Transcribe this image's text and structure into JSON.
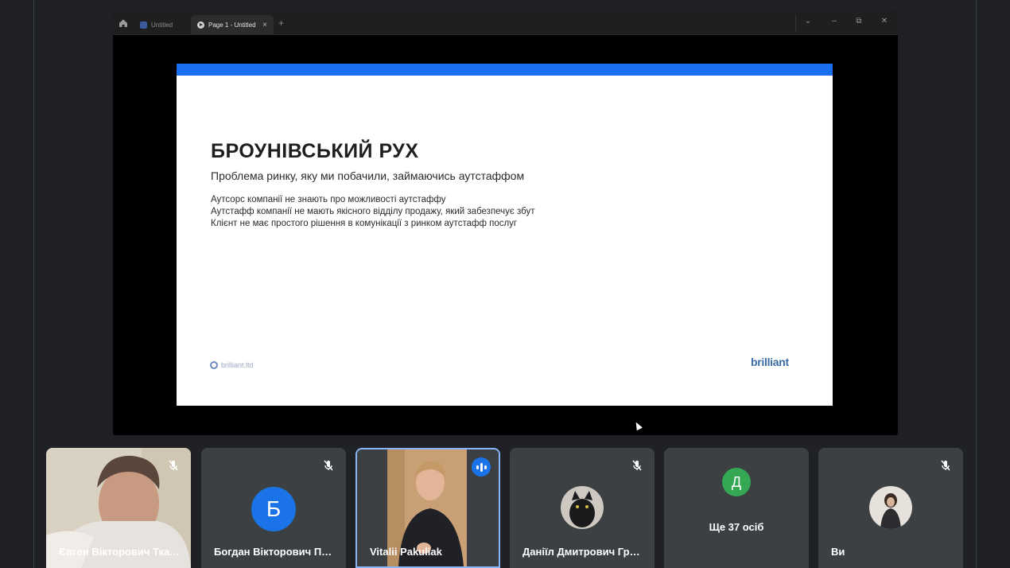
{
  "screen": {
    "tabs": [
      {
        "label": "Untitled"
      },
      {
        "label": "Page 1 - Untitled",
        "close": "×"
      }
    ],
    "add_tab": "+",
    "window_controls": {
      "chevron": "⌄",
      "minimize": "–",
      "restore": "⧉",
      "close": "✕"
    }
  },
  "slide": {
    "title": "БРОУНІВСЬКИЙ РУХ",
    "subtitle": "Проблема ринку, яку ми побачили, займаючись аутстаффом",
    "lines": [
      "Аутсорс компанії не знають про можливості аутстаффу",
      "Аутстафф компанії не мають якісного відділу продажу, який забезпечує збут",
      "Клієнт не має простого рішення в комунікації з ринком аутстафф послуг"
    ],
    "footer_left": "brilliant.ltd",
    "footer_right": "brilliant"
  },
  "participants": [
    {
      "name": "Євген Вікторович Ткачук",
      "muted": true
    },
    {
      "name": "Богдан Вікторович Петренко",
      "muted": true,
      "initial": "Б",
      "color": "#1a73e8"
    },
    {
      "name": "Vitalii Pakuliak",
      "speaking": true
    },
    {
      "name": "Даніїл Дмитрович Гриценко",
      "muted": true
    },
    {
      "more": "Ще 37 осіб",
      "initial": "Д",
      "color": "#34a853"
    },
    {
      "name": "Ви",
      "muted": true
    }
  ],
  "colors": {
    "slide_accent": "#1a6ef0",
    "active_tile_border": "#8ab4f8",
    "speaking_badge": "#1a73e8"
  }
}
